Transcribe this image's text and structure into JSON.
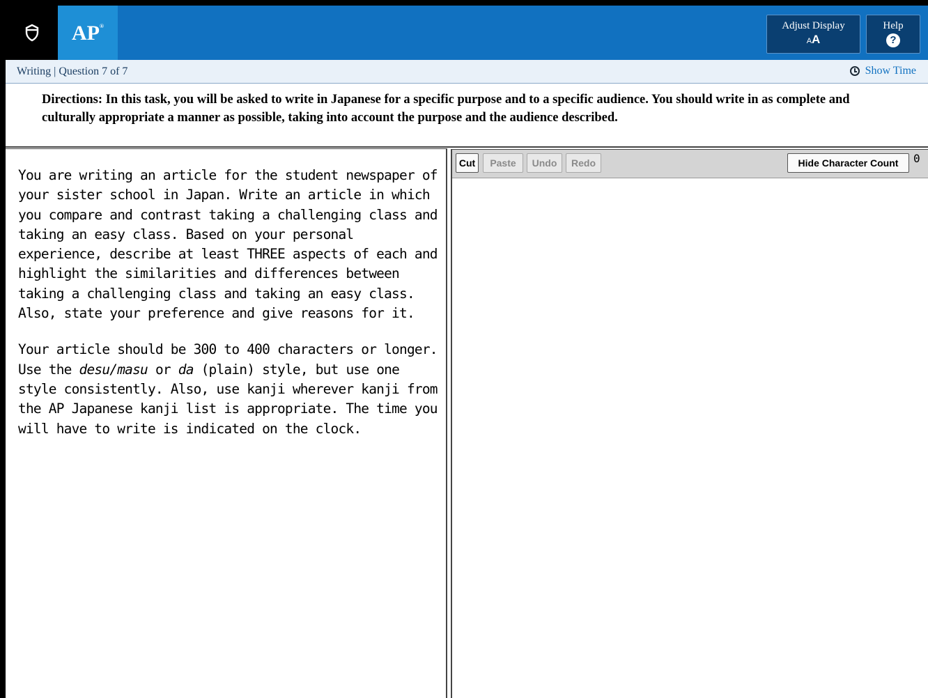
{
  "header": {
    "brand": "AP",
    "brand_mark": "®",
    "adjust_display_label": "Adjust Display",
    "adjust_display_icon_small": "A",
    "adjust_display_icon_big": "A",
    "help_label": "Help",
    "help_icon_glyph": "?",
    "logo_icon": "acorn-icon",
    "colors": {
      "bar": "#1171c0",
      "brand_box": "#1e8fd6",
      "button": "#0a3f71"
    }
  },
  "subbar": {
    "section": "Writing | Question 7 of 7",
    "show_time_label": "Show Time",
    "clock_icon": "clock-icon"
  },
  "directions": "Directions: In this task, you will be asked to write in Japanese for a specific purpose and to a specific audience. You should write in as complete and culturally appropriate a manner as possible, taking into account the purpose and the audience described.",
  "prompt": {
    "p1": "You are writing an article for the student newspaper of your sister school in Japan. Write an article in which you compare and contrast taking a challenging class and taking an easy class. Based on your personal experience, describe at least THREE aspects of each and highlight the similarities and differences between taking a challenging class and taking an easy class. Also, state your preference and give reasons for it.",
    "p2_a": "Your article should be 300 to 400 characters or longer. Use the ",
    "p2_em1": "desu/masu",
    "p2_b": " or ",
    "p2_em2": "da",
    "p2_c": " (plain) style, but use one style consistently. Also, use kanji wherever kanji from the AP Japanese kanji list is appropriate. The time you will have to write is indicated on the clock."
  },
  "toolbar": {
    "cut": "Cut",
    "paste": "Paste",
    "undo": "Undo",
    "redo": "Redo",
    "hide_count": "Hide Character Count",
    "char_count": "0"
  },
  "editor": {
    "value": ""
  }
}
